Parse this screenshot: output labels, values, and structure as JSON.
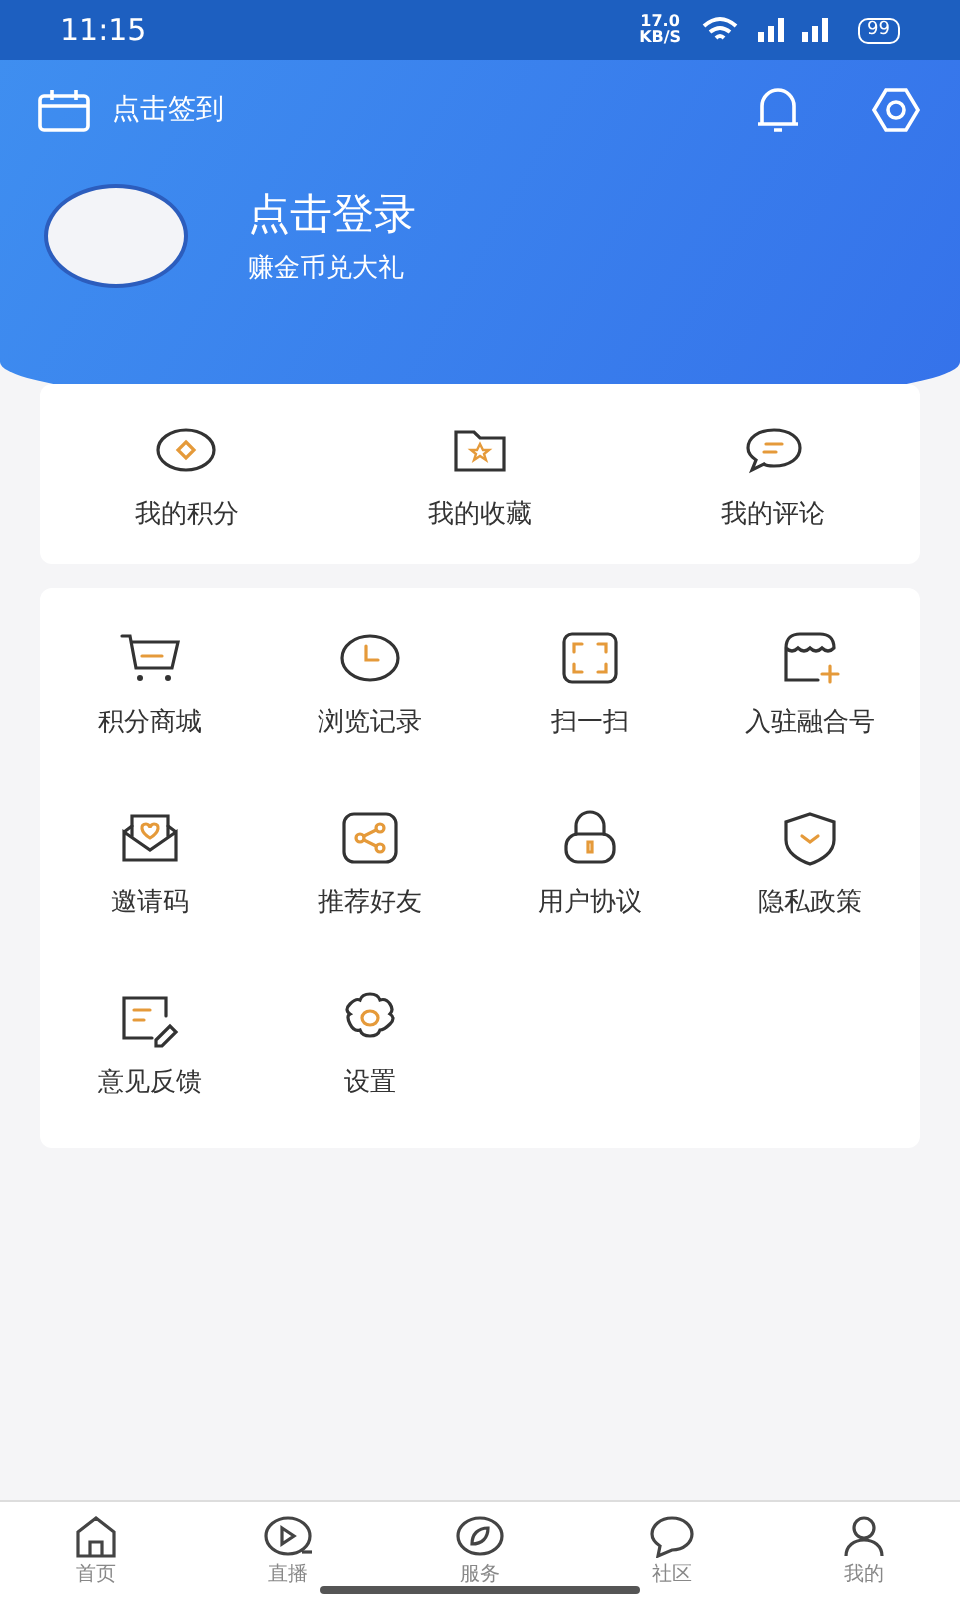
{
  "status_bar": {
    "time": "11:15",
    "speed": "17.0",
    "speed_unit": "KB/S",
    "battery": "99"
  },
  "header": {
    "checkin": "点击签到",
    "login_title": "点击登录",
    "login_subtitle": "赚金币兑大礼"
  },
  "quick_links": [
    {
      "label": "我的积分"
    },
    {
      "label": "我的收藏"
    },
    {
      "label": "我的评论"
    }
  ],
  "services": [
    {
      "label": "积分商城"
    },
    {
      "label": "浏览记录"
    },
    {
      "label": "扫一扫"
    },
    {
      "label": "入驻融合号"
    },
    {
      "label": "邀请码"
    },
    {
      "label": "推荐好友"
    },
    {
      "label": "用户协议"
    },
    {
      "label": "隐私政策"
    },
    {
      "label": "意见反馈"
    },
    {
      "label": "设置"
    }
  ],
  "bottom_nav": [
    {
      "label": "首页",
      "selected": false
    },
    {
      "label": "直播",
      "selected": false
    },
    {
      "label": "服务",
      "selected": false
    },
    {
      "label": "社区",
      "selected": false
    },
    {
      "label": "我的",
      "selected": false
    }
  ]
}
